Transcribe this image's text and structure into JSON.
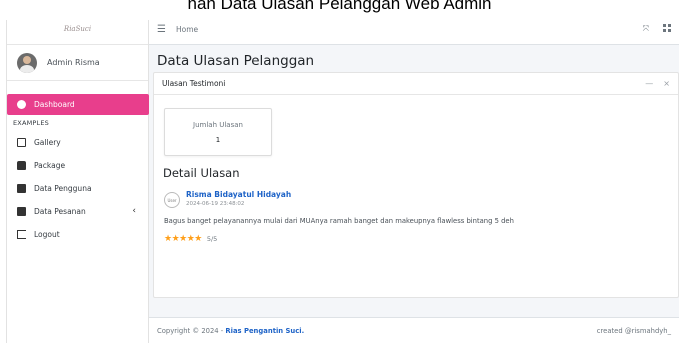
{
  "caption": "nan Data Ulasan Pelanggan Web Admin",
  "brand": {
    "logo_text": "RiaSuci"
  },
  "user": {
    "name": "Admin Risma"
  },
  "nav": {
    "dashboard": "Dashboard",
    "section_examples": "EXAMPLES",
    "gallery": "Gallery",
    "package": "Package",
    "data_pengguna": "Data Pengguna",
    "data_pesanan": "Data Pesanan",
    "logout": "Logout",
    "active_color": "#e83e8c"
  },
  "topbar": {
    "home": "Home"
  },
  "page": {
    "title": "Data Ulasan Pelanggan"
  },
  "card": {
    "title": "Ulasan Testimoni",
    "stat_label": "Jumlah Ulasan",
    "stat_value": "1",
    "section_title": "Detail Ulasan"
  },
  "review": {
    "avatar_alt": "User",
    "name": "Risma Bidayatul Hidayah",
    "date": "2024-06-19 23:48:02",
    "text": "Bagus banget pelayanannya mulai dari MUAnya ramah banget dan makeupnya flawless bintang 5 deh",
    "stars": "★★★★★",
    "rating": "5/5"
  },
  "footer": {
    "copyright_prefix": "Copyright © 2024 - ",
    "brand": "Rias Pengantin Suci.",
    "created": "created @rismahdyh_"
  }
}
